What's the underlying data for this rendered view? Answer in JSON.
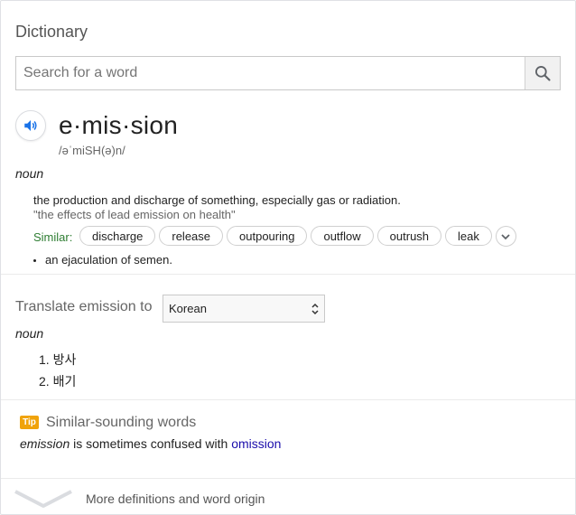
{
  "header": {
    "title": "Dictionary"
  },
  "search": {
    "placeholder": "Search for a word",
    "icon": "search-icon"
  },
  "entry": {
    "word": "e·mis·sion",
    "phonetic": "/əˈmiSH(ə)n/",
    "part_of_speech": "noun",
    "definition": "the production and discharge of something, especially gas or radiation.",
    "example": "\"the effects of lead emission on health\"",
    "similar_label": "Similar:",
    "similar": [
      "discharge",
      "release",
      "outpouring",
      "outflow",
      "outrush",
      "leak"
    ],
    "sub_definitions": [
      "an ejaculation of semen."
    ]
  },
  "translate": {
    "label": "Translate emission to",
    "language": "Korean",
    "part_of_speech": "noun",
    "items": [
      "1. 방사",
      "2. 배기"
    ]
  },
  "tip": {
    "badge": "Tip",
    "title": "Similar-sounding words",
    "word": "emission",
    "middle": " is sometimes confused with ",
    "link": "omission"
  },
  "footer": {
    "more_label": "More definitions and word origin"
  },
  "colors": {
    "accent_blue": "#1a73e8",
    "similar_green": "#2e7d32",
    "tip_orange": "#f0a30a",
    "link": "#1a0dab"
  }
}
